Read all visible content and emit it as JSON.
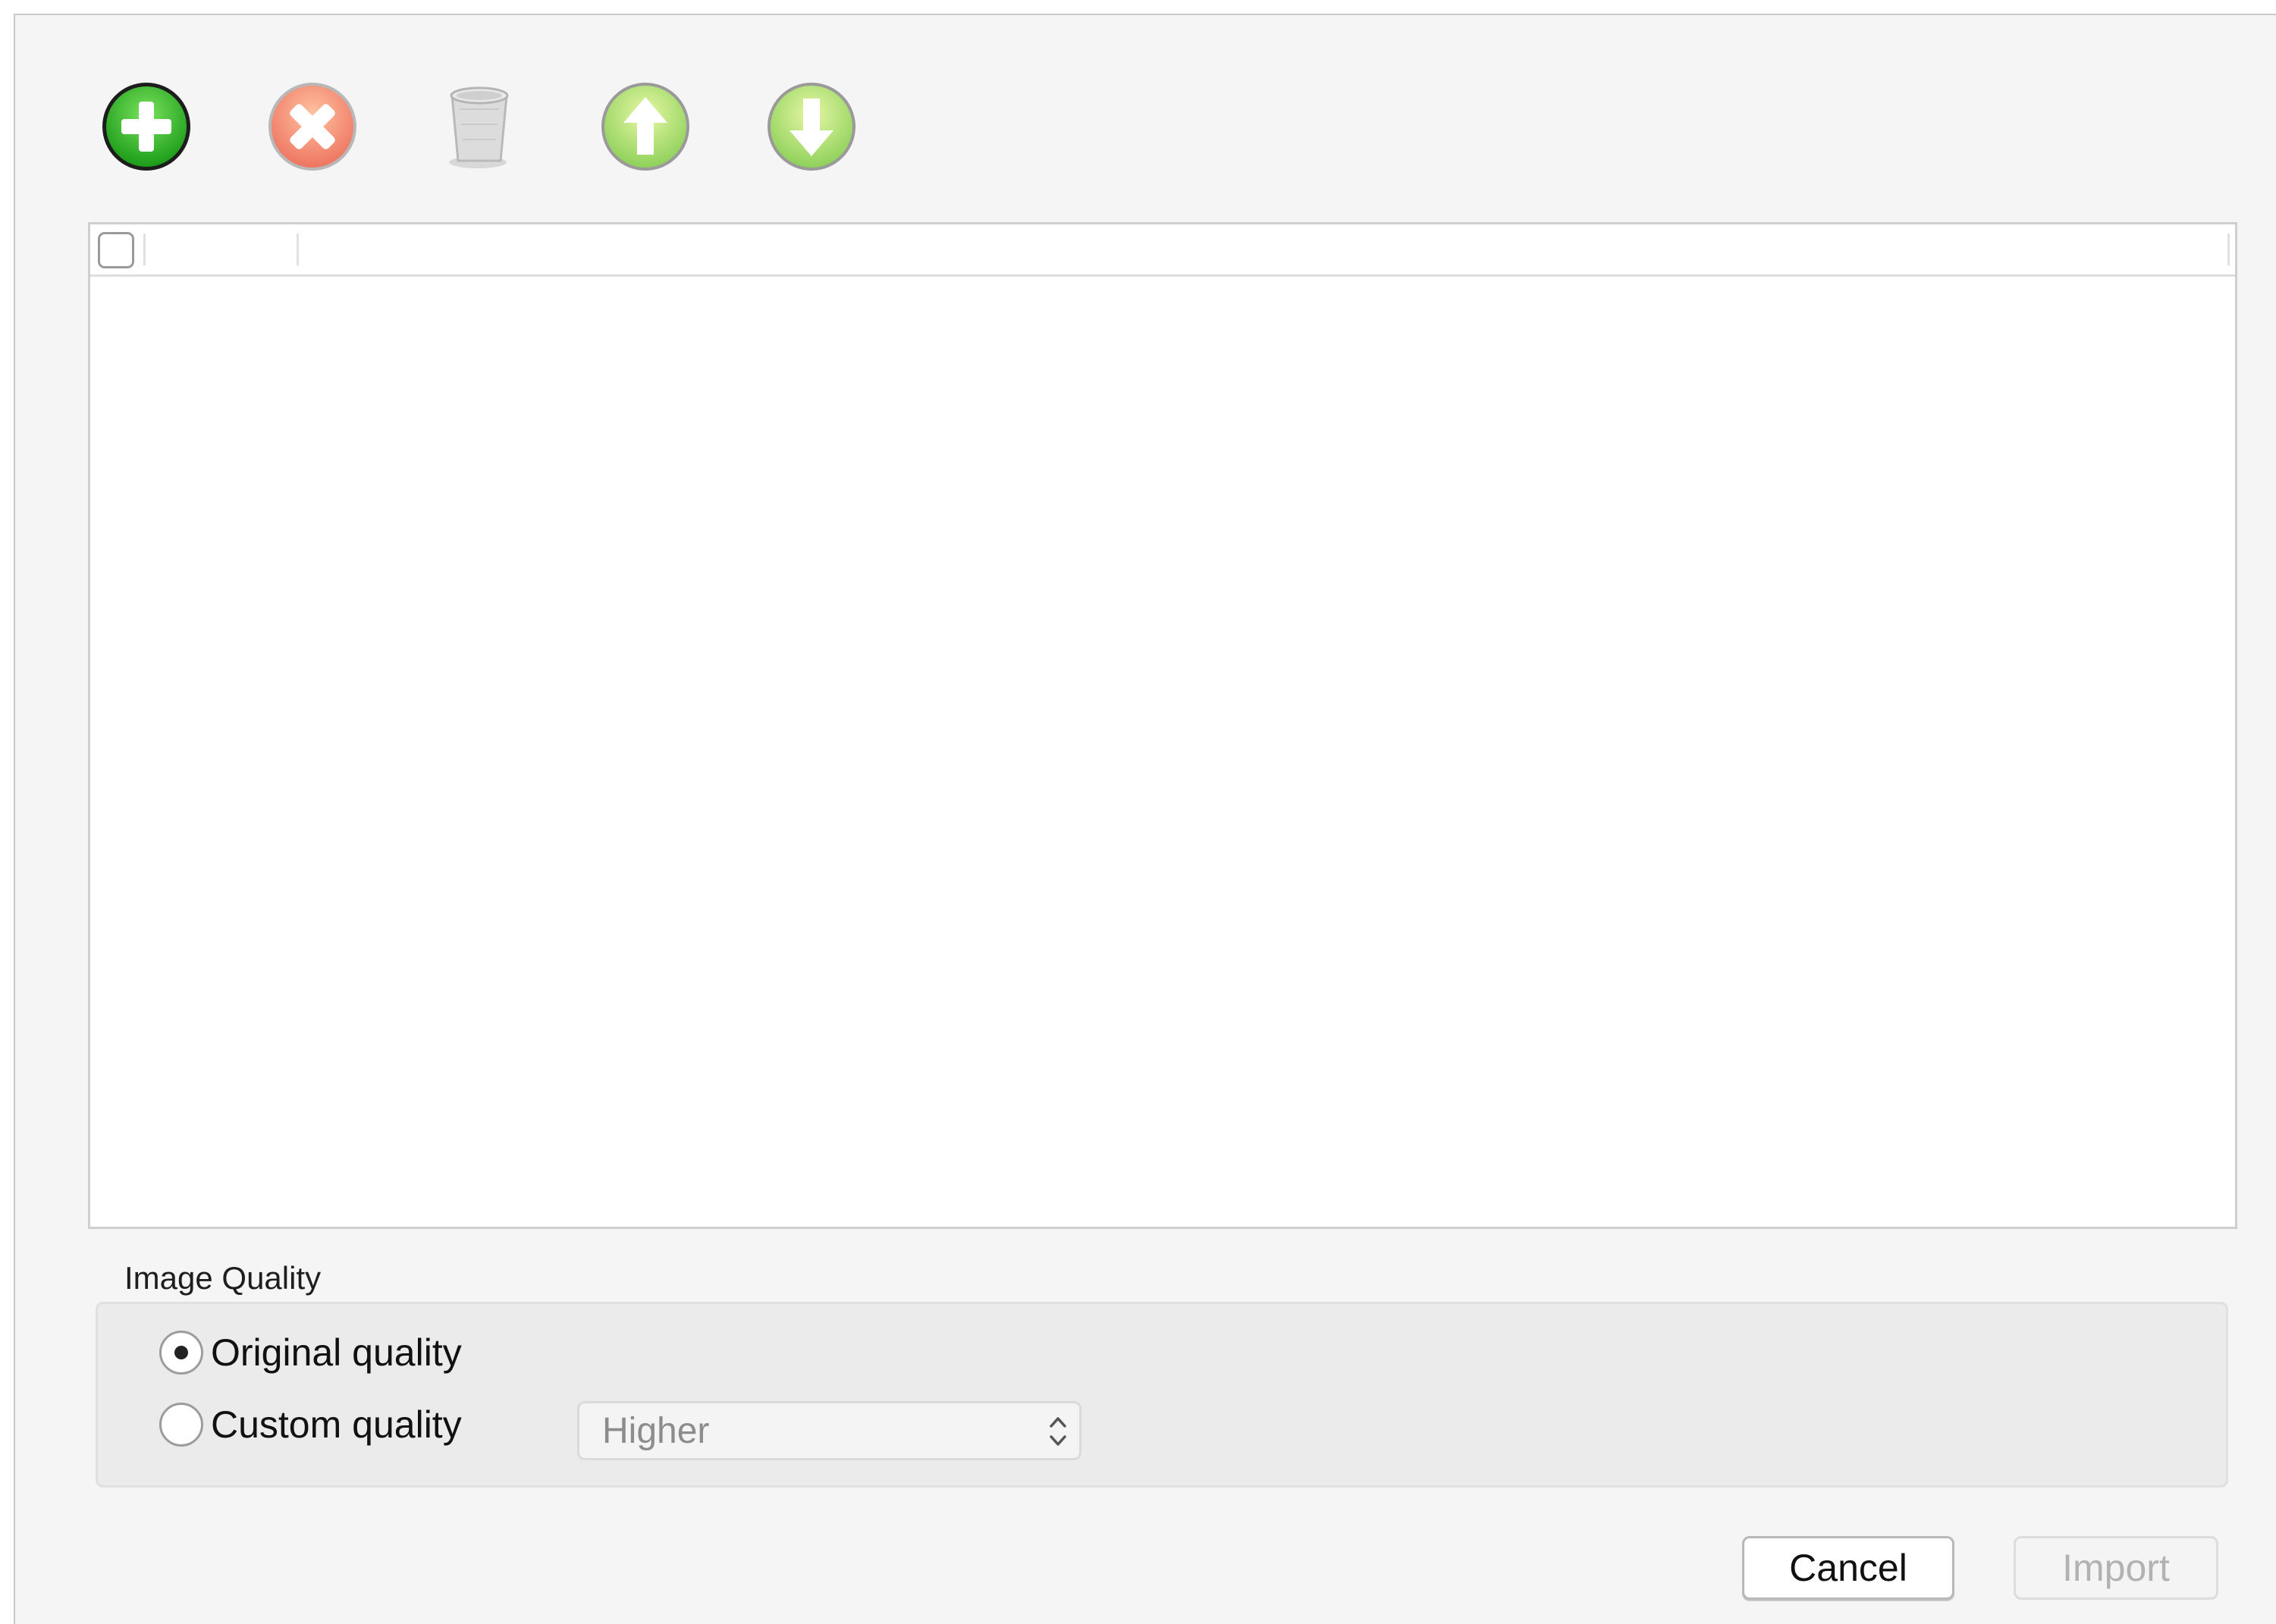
{
  "toolbar": {
    "buttons": [
      {
        "icon": "add-icon",
        "color": "#2fb52a"
      },
      {
        "icon": "remove-icon",
        "color": "#f08a6c"
      },
      {
        "icon": "trash-icon",
        "color": "#b5b5b5"
      },
      {
        "icon": "arrow-up-icon",
        "color": "#9ed35c"
      },
      {
        "icon": "arrow-down-icon",
        "color": "#9ed35c"
      }
    ]
  },
  "file_table": {
    "header_checkbox_checked": false,
    "rows": []
  },
  "image_quality": {
    "group_label": "Image Quality",
    "original_label": "Original quality",
    "custom_label": "Custom quality",
    "selected": "original",
    "custom_select_value": "Higher"
  },
  "footer": {
    "cancel_label": "Cancel",
    "import_label": "Import"
  }
}
